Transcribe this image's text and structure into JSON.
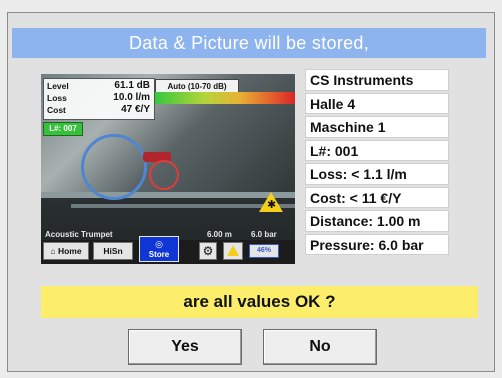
{
  "dialog": {
    "title": "Data & Picture will be stored,",
    "question": "are all values OK ?",
    "yes_label": "Yes",
    "no_label": "No"
  },
  "screenshot": {
    "readings": [
      {
        "label": "Level",
        "value": "61.1 dB"
      },
      {
        "label": "Loss",
        "value": "10.0 l/m"
      },
      {
        "label": "Cost",
        "value": "47 €/Y"
      }
    ],
    "leak_number": "L#: 007",
    "mode_label": "Auto (10-70 dB)",
    "source_label": "Acoustic Trumpet",
    "distance_label": "6.00 m",
    "pressure_label": "6.0 bar",
    "toolbar": {
      "home_label": "Home",
      "hisn_label": "HiSn",
      "store_label": "Store",
      "battery_label": "46%"
    },
    "colors": {
      "leak_number_bg": "#36c13a",
      "store_bg": "#1136d6",
      "warning": "#f3cf1a"
    }
  },
  "info": {
    "rows": [
      "CS Instruments",
      "Halle 4",
      "Maschine 1",
      "L#: 001",
      "Loss: < 1.1 l/m",
      "Cost: < 11 €/Y",
      "Distance: 1.00 m",
      "Pressure: 6.0 bar"
    ]
  },
  "colors": {
    "title_bg": "#8db4ee",
    "question_bg": "#fcee6b",
    "dialog_bg": "#e1e1e1"
  }
}
